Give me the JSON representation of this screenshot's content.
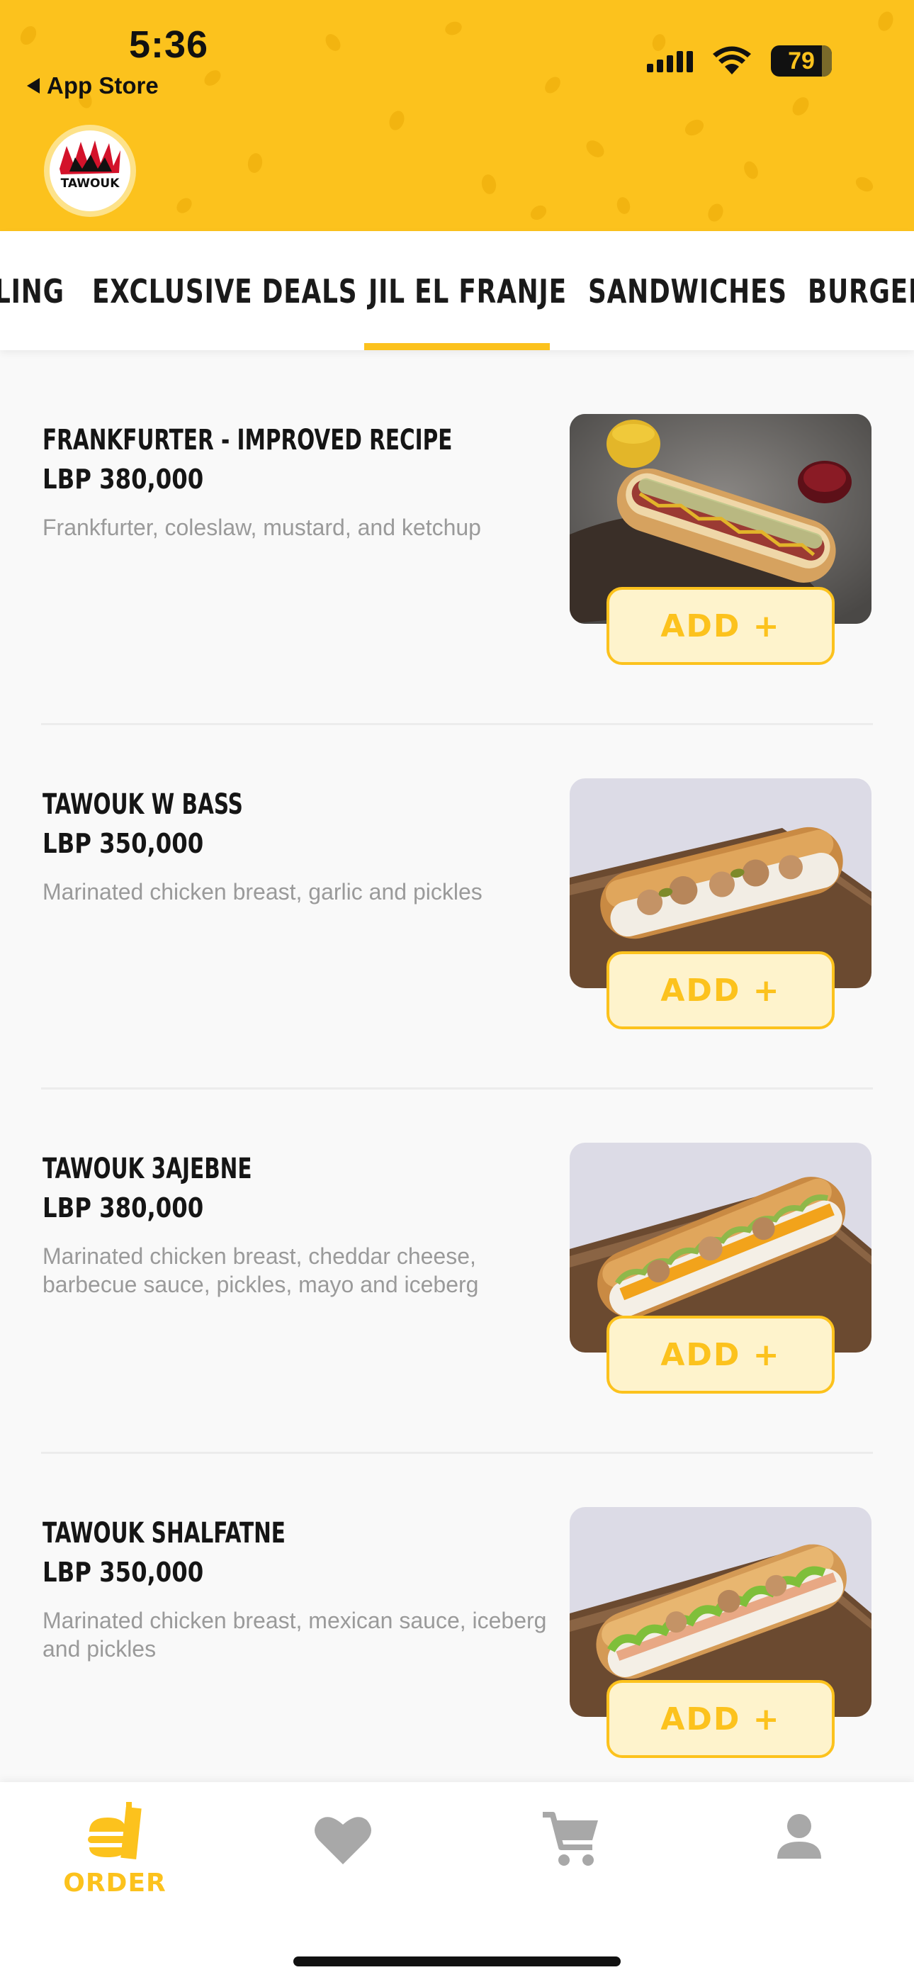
{
  "status_bar": {
    "time": "5:36",
    "back_label": "App Store",
    "battery": "79"
  },
  "brand": {
    "logo_text": "TAWOUK",
    "accent_color": "#fcc21d"
  },
  "tabs": [
    {
      "label": "LING",
      "active": false
    },
    {
      "label": "EXCLUSIVE DEALS",
      "active": false
    },
    {
      "label": "JIL EL FRANJE",
      "active": true
    },
    {
      "label": "SANDWICHES",
      "active": false
    },
    {
      "label": "BURGER",
      "active": false
    }
  ],
  "menu_items": [
    {
      "name": "FRANKFURTER - IMPROVED RECIPE",
      "price": "LBP 380,000",
      "description": "Frankfurter, coleslaw, mustard, and ketchup",
      "add_label": "ADD +"
    },
    {
      "name": "TAWOUK W BASS",
      "price": "LBP 350,000",
      "description": "Marinated chicken breast, garlic and pickles",
      "add_label": "ADD +"
    },
    {
      "name": "TAWOUK 3AJEBNE",
      "price": "LBP 380,000",
      "description": "Marinated chicken breast, cheddar cheese, barbecue sauce, pickles, mayo and iceberg",
      "add_label": "ADD +"
    },
    {
      "name": "TAWOUK SHALFATNE",
      "price": "LBP 350,000",
      "description": "Marinated chicken breast, mexican sauce, iceberg and pickles",
      "add_label": "ADD +"
    }
  ],
  "bottom_nav": {
    "order_label": "ORDER",
    "items": [
      "order-icon",
      "heart-icon",
      "cart-icon",
      "profile-icon"
    ]
  }
}
